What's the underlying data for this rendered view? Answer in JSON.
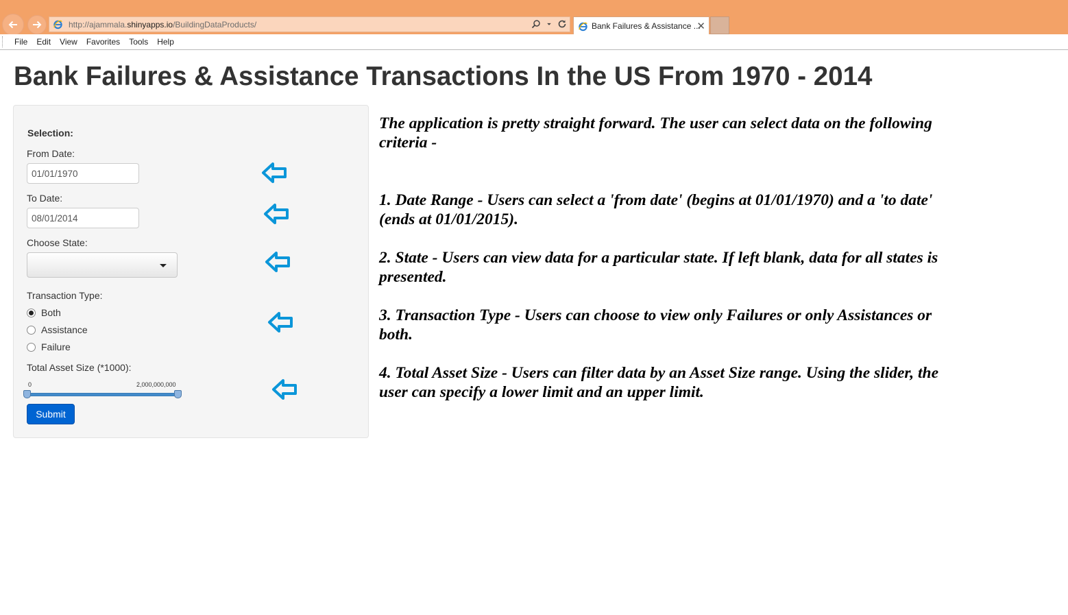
{
  "browser": {
    "url_prefix": "http://ajammala.",
    "url_host": "shinyapps.io",
    "url_path": "/BuildingDataProducts/",
    "tab_title": "Bank Failures & Assistance ...",
    "tab_close": "✕",
    "menu": [
      "File",
      "Edit",
      "View",
      "Favorites",
      "Tools",
      "Help"
    ]
  },
  "page": {
    "title": "Bank Failures & Assistance Transactions In the US From 1970 - 2014"
  },
  "sidebar": {
    "selection_label": "Selection:",
    "from_date_label": "From Date:",
    "from_date_value": "01/01/1970",
    "to_date_label": "To Date:",
    "to_date_value": "08/01/2014",
    "state_label": "Choose State:",
    "state_value": "",
    "transaction_label": "Transaction Type:",
    "transaction_options": [
      "Both",
      "Assistance",
      "Failure"
    ],
    "transaction_selected": "Both",
    "asset_label": "Total Asset Size (*1000):",
    "asset_min": "0",
    "asset_max": "2,000,000,000",
    "submit_label": "Submit"
  },
  "description": {
    "intro": "The application is pretty straight forward. The user can select data on the following criteria -",
    "items": [
      "1. Date Range - Users can select a 'from date' (begins at 01/01/1970) and a 'to date' (ends at 01/01/2015).",
      "2. State - Users can view data for a particular state. If left blank, data for all states is presented.",
      "3. Transaction Type - Users can choose to view only Failures or only Assistances or both.",
      "4. Total Asset Size - Users can filter data by an Asset Size range. Using the slider, the user can specify a lower limit and an upper limit."
    ]
  },
  "colors": {
    "chrome": "#f3a267",
    "arrow": "#0b96d9",
    "submit": "#0064d2"
  }
}
